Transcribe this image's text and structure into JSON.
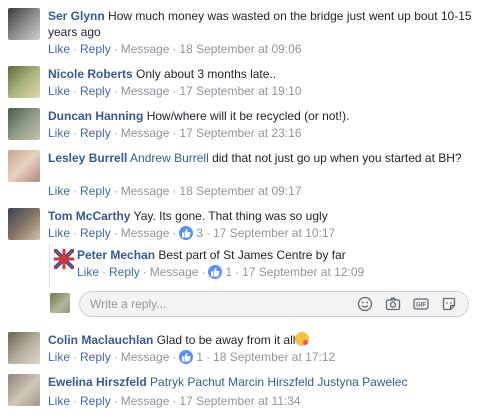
{
  "actions": {
    "like": "Like",
    "reply": "Reply",
    "message": "Message",
    "dot": "·"
  },
  "comments": [
    {
      "name": "Ser Glynn",
      "text": "How much money was wasted on the bridge just went up bout 10-15 years ago",
      "time": "18 September at 09:06"
    },
    {
      "name": "Nicole Roberts",
      "text": "Only about 3 months late..",
      "time": "17 September at 19:10"
    },
    {
      "name": "Duncan Hanning",
      "text": "How/where will it be recycled (or not!).",
      "time": "17 September at 23:16"
    },
    {
      "name": "Lesley Burrell",
      "tag": "Andrew Burrell",
      "text": "did that not just go up when you started at BH?",
      "time": "18 September at 09:17"
    },
    {
      "name": "Tom McCarthy",
      "text": "Yay. Its gone. That thing was so ugly",
      "likes": "3",
      "time": "17 September at 10:17"
    },
    {
      "name": "Peter Mechan",
      "text": "Best part of St James Centre by far",
      "likes": "1",
      "time": "17 September at 12:09"
    },
    {
      "name": "Colin Maclauchlan",
      "text": "Glad to be away from it all",
      "likes": "1",
      "time": "18 September at 17:12"
    },
    {
      "name": "Ewelina Hirszfeld",
      "tags": "Patryk Pachut Marcin Hirszfeld Justyna Pawelec",
      "time": "17 September at 11:34"
    }
  ],
  "reply_box": {
    "placeholder": "Write a reply..."
  },
  "icons": {
    "like_reaction": "thumbs-up-icon",
    "emoji": "smiley-icon",
    "camera": "camera-icon",
    "gif": "gif-icon",
    "sticker": "sticker-icon"
  },
  "colors": {
    "name_link": "#385898",
    "action_link": "#4267b2",
    "meta": "#90949c",
    "like_badge": "#5890ff"
  }
}
